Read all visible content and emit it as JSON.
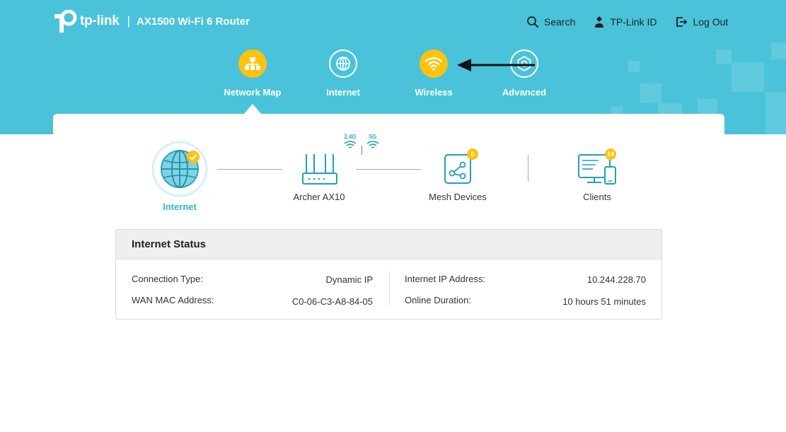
{
  "brand": {
    "logo_text": "tp-link",
    "separator": "|",
    "model": "AX1500 Wi-Fi 6 Router"
  },
  "top_links": [
    {
      "label": "Search",
      "icon": "search-icon"
    },
    {
      "label": "TP-Link ID",
      "icon": "person-icon"
    },
    {
      "label": "Log Out",
      "icon": "logout-icon"
    }
  ],
  "nav": [
    {
      "label": "Network Map",
      "icon": "network-map-icon",
      "active": true
    },
    {
      "label": "Internet",
      "icon": "globe-icon",
      "active": false
    },
    {
      "label": "Wireless",
      "icon": "wifi-icon",
      "active": false
    },
    {
      "label": "Advanced",
      "icon": "gear-icon",
      "active": false
    }
  ],
  "topology": {
    "internet_label": "Internet",
    "router_label": "Archer AX10",
    "band_24": "2.4G",
    "band_5": "5G",
    "mesh_label": "Mesh Devices",
    "mesh_count": "0",
    "clients_label": "Clients",
    "clients_count": "14"
  },
  "status": {
    "title": "Internet Status",
    "connection_type_label": "Connection Type:",
    "connection_type_value": "Dynamic IP",
    "wan_mac_label": "WAN MAC Address:",
    "wan_mac_value": "C0-06-C3-A8-84-05",
    "ip_label": "Internet IP Address:",
    "ip_value": "10.244.228.70",
    "duration_label": "Online Duration:",
    "duration_value": "10 hours 51 minutes"
  },
  "colors": {
    "header": "#4ac3da",
    "accent": "#ffc20e",
    "active_label": "#2fb7cd"
  }
}
